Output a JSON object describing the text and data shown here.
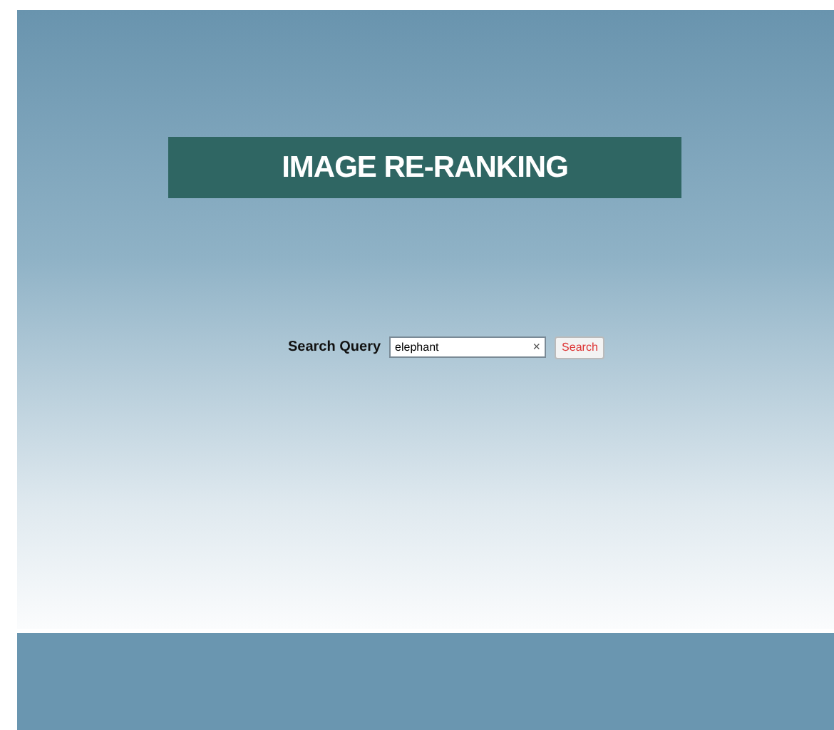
{
  "header": {
    "title": "IMAGE RE-RANKING"
  },
  "search": {
    "label": "Search Query",
    "value": "elephant",
    "clear_symbol": "×",
    "button": "Search"
  }
}
